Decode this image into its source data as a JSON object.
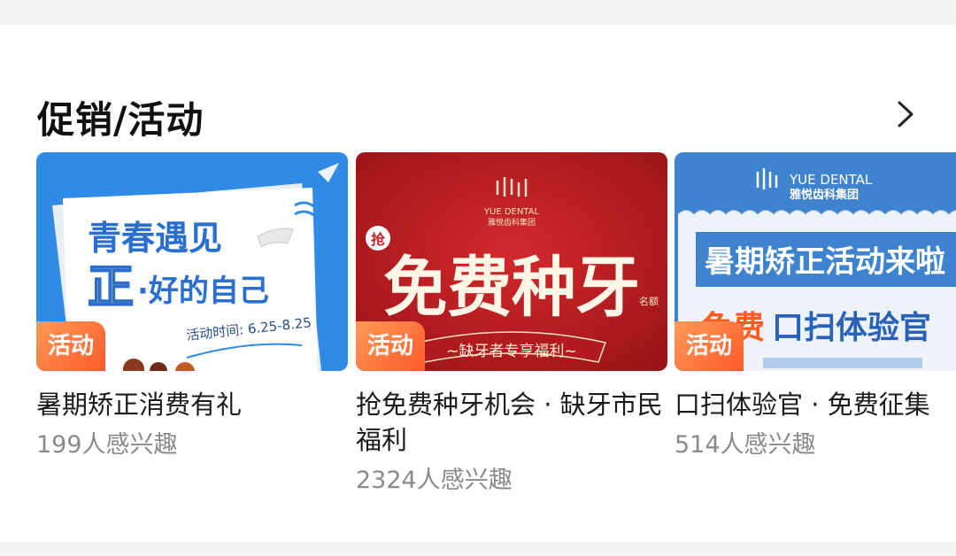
{
  "section": {
    "title": "促销/活动"
  },
  "promos": [
    {
      "name": "暑期矫正消费有礼",
      "interest": "199人感兴趣",
      "badge": "活动",
      "poster": {
        "line1": "青春遇见",
        "line2_big": "正",
        "line2_rest": "·好的自己",
        "date": "活动时间: 6.25-8.25"
      }
    },
    {
      "name": "抢免费种牙机会 · 缺牙市民福利",
      "interest": "2324人感兴趣",
      "badge": "活动",
      "poster": {
        "brand_en": "YUE DENTAL",
        "brand_cn": "雅悦齿科集团",
        "qiang": "抢",
        "headline": "免费种牙",
        "quota": "名额",
        "ribbon": "~缺牙者专享福利~"
      }
    },
    {
      "name": "口扫体验官 · 免费征集",
      "interest": "514人感兴趣",
      "badge": "活动",
      "poster": {
        "brand_en": "YUE DENTAL",
        "brand_cn": "雅悦齿科集团",
        "banner": "暑期矫正活动来啦",
        "sub_red": "免费",
        "sub_blue": "口扫体验官"
      }
    }
  ],
  "colors": {
    "badge": "#ff6a33",
    "poster1_bg": "#2f8be6",
    "poster2_bg": "#b81d22",
    "poster3_bg": "#3f83cf"
  }
}
